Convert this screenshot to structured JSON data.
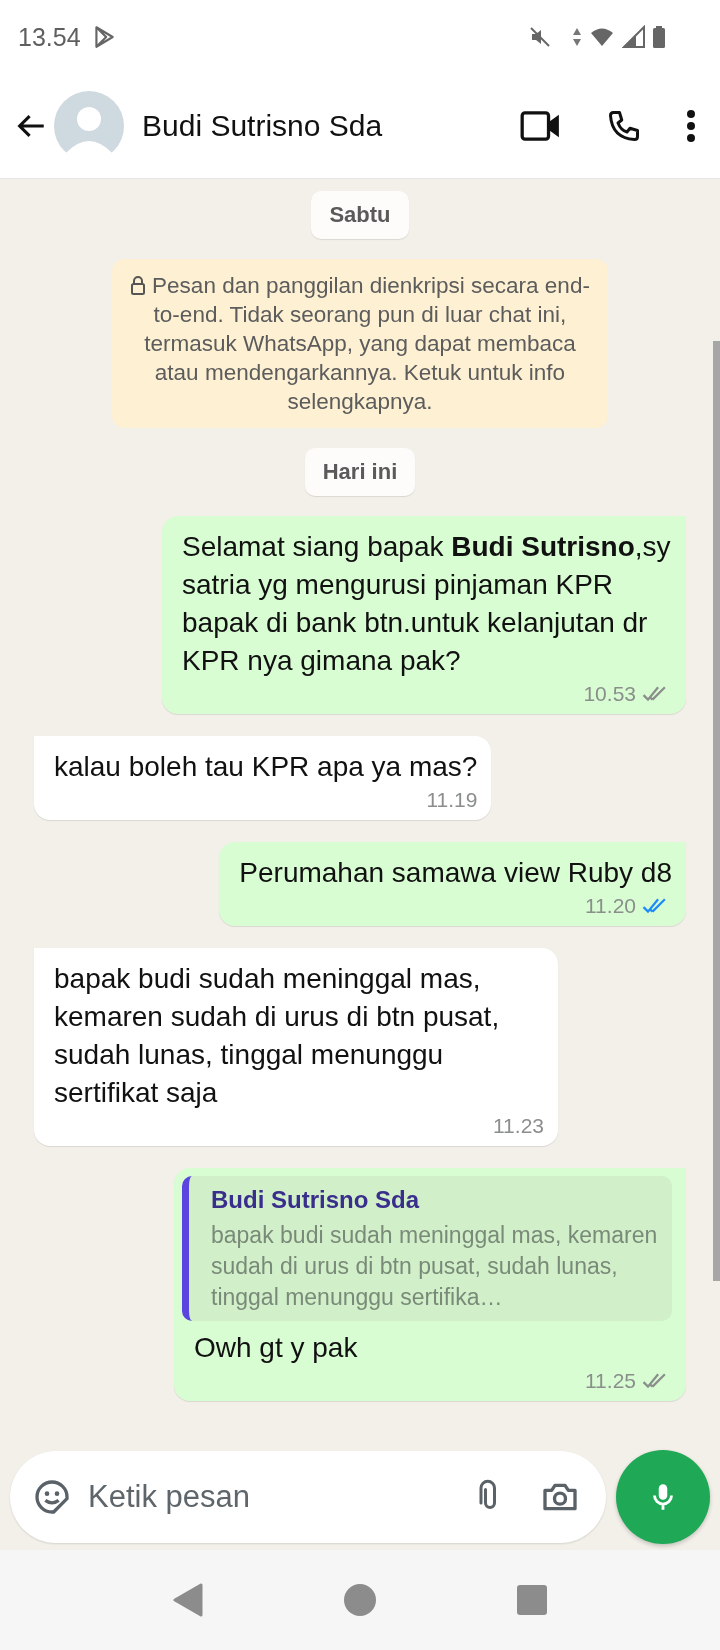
{
  "status_bar": {
    "time": "13.54"
  },
  "header": {
    "contact_name": "Budi Sutrisno Sda"
  },
  "chat": [
    {
      "kind": "date",
      "text": "Sabtu"
    },
    {
      "kind": "notice",
      "text": "Pesan dan panggilan dienkripsi secara end-to-end. Tidak seorang pun di luar chat ini, termasuk WhatsApp, yang dapat membaca atau mendengarkannya. Ketuk untuk info selengkapnya."
    },
    {
      "kind": "date",
      "text": "Hari ini"
    },
    {
      "kind": "outgoing",
      "text": "Selamat siang bapak **Budi Sutrisno**,sy satria yg mengurusi pinjaman KPR bapak di bank btn.untuk kelanjutan dr KPR nya gimana pak?",
      "time": "10.53",
      "read": false
    },
    {
      "kind": "incoming",
      "text": "kalau boleh tau KPR apa ya mas?",
      "time": "11.19"
    },
    {
      "kind": "outgoing",
      "text": "Perumahan samawa view Ruby d8",
      "time": "11.20",
      "read": true
    },
    {
      "kind": "incoming",
      "text": "bapak budi sudah meninggal mas, kemaren sudah di urus di btn pusat, sudah lunas, tinggal menunggu sertifikat saja",
      "time": "11.23"
    },
    {
      "kind": "outgoing",
      "quote": {
        "author": "Budi Sutrisno Sda",
        "text": "bapak budi sudah meninggal mas, kemaren sudah di urus di btn pusat, sudah lunas, tinggal menunggu sertifika…"
      },
      "text": "Owh gt y pak",
      "time": "11.25",
      "read": false
    }
  ],
  "composer": {
    "placeholder": "Ketik pesan"
  }
}
